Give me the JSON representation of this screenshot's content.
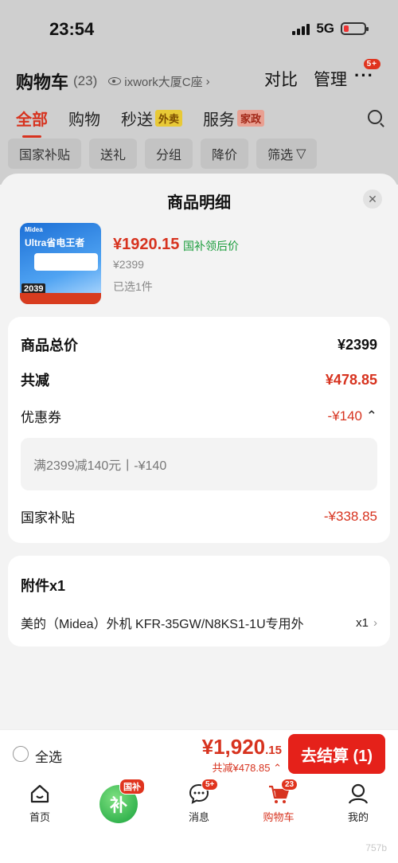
{
  "status": {
    "time": "23:54",
    "network": "5G"
  },
  "cart": {
    "title": "购物车",
    "count": "(23)",
    "location": "ixwork大厦C座",
    "compare": "对比",
    "manage": "管理",
    "more_badge": "5+",
    "tabs": [
      {
        "label": "全部",
        "active": true
      },
      {
        "label": "购物"
      },
      {
        "label": "秒送",
        "tag": "外卖"
      },
      {
        "label": "服务",
        "tag": "家政"
      }
    ],
    "filters": [
      "国家补贴",
      "送礼",
      "分组",
      "降价",
      "筛选"
    ]
  },
  "sheet": {
    "title": "商品明细",
    "product": {
      "price": "¥1920.15",
      "price_note": "国补领后价",
      "original": "¥2399",
      "selected": "已选1件",
      "image_brand": "Midea",
      "image_headline": "Ultra省电王者",
      "image_price": "2039"
    },
    "summary": {
      "total_label": "商品总价",
      "total_value": "¥2399",
      "reduce_label": "共减",
      "reduce_value": "¥478.85",
      "coupon_label": "优惠券",
      "coupon_value": "-¥140",
      "coupon_detail": "满2399减140元丨-¥140",
      "subsidy_label": "国家补贴",
      "subsidy_value": "-¥338.85"
    },
    "accessory": {
      "title": "附件x1",
      "name": "美的（Midea）外机 KFR-35GW/N8KS1-1U专用外",
      "qty": "x1"
    }
  },
  "checkout": {
    "select_all": "全选",
    "total_main": "¥1,920",
    "total_cents": ".15",
    "total_save": "共减¥478.85",
    "button": "去结算 (1)"
  },
  "tabbar": {
    "items": [
      {
        "label": "首页"
      },
      {
        "label": "补",
        "badge": "国补"
      },
      {
        "label": "消息",
        "badge": "5+"
      },
      {
        "label": "购物车",
        "badge": "23",
        "active": true
      },
      {
        "label": "我的"
      }
    ]
  },
  "watermark": "757b"
}
